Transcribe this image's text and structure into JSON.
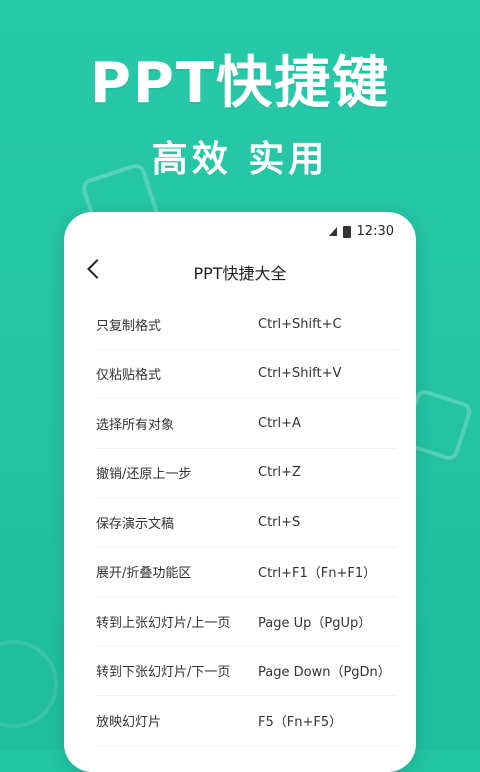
{
  "hero": {
    "title": "PPT快捷键",
    "subtitle": "高效  实用"
  },
  "status_bar": {
    "time": "12:30"
  },
  "navbar": {
    "title": "PPT快捷大全"
  },
  "shortcuts": [
    {
      "name": "只复制格式",
      "keys": "Ctrl+Shift+C"
    },
    {
      "name": "仅粘贴格式",
      "keys": "Ctrl+Shift+V"
    },
    {
      "name": "选择所有对象",
      "keys": "Ctrl+A"
    },
    {
      "name": "撤销/还原上一步",
      "keys": "Ctrl+Z"
    },
    {
      "name": "保存演示文稿",
      "keys": "Ctrl+S"
    },
    {
      "name": "展开/折叠功能区",
      "keys": "Ctrl+F1（Fn+F1）"
    },
    {
      "name": "转到上张幻灯片/上一页",
      "keys": "Page Up（PgUp）"
    },
    {
      "name": "转到下张幻灯片/下一页",
      "keys": "Page Down（PgDn）"
    },
    {
      "name": "放映幻灯片",
      "keys": "F5（Fn+F5）"
    }
  ],
  "colors": {
    "background": "#22c4a4",
    "card": "#ffffff",
    "text": "#333333"
  },
  "icons": [
    "signal-icon",
    "battery-icon",
    "back-arrow-icon"
  ]
}
